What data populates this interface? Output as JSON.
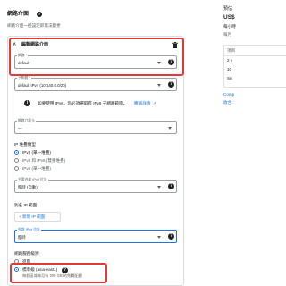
{
  "header": {
    "title": "網路介面",
    "subtitle": "網路介面一經設定即無法變更"
  },
  "nic_card": {
    "title": "編輯網路介面",
    "network": {
      "label": "網路 *",
      "value": "default"
    },
    "subnetwork": {
      "label": "子網路 *",
      "value": "default IPv4 (10.140.0.0/20)"
    },
    "ipv6_notice": {
      "text": "如要使用 IPv6，您必須選取有 IPv6 子網路範圍。",
      "link": "瞭解詳情"
    },
    "nic_type": {
      "label": "網路介面卡",
      "value": "—"
    },
    "ip_stack": {
      "heading": "IP 堆疊類型",
      "options": [
        "IPv4 (單一堆疊)",
        "IPv4 和 IPv6 (雙重堆疊)",
        "IPv6 (單一堆疊)"
      ],
      "selected": 0
    },
    "internal_ip": {
      "label": "主要內部 IPv4 位址",
      "value": "臨時 (自動)"
    },
    "alias_ip": {
      "heading": "別名 IP 範圍",
      "button": "+ 新增 IP 範圍"
    },
    "external_ip": {
      "label": "外部 IPv4 位址",
      "value": "臨時"
    },
    "network_tier": {
      "heading": "網路服務級別",
      "options": [
        "進階",
        "標準級 (asia-east1)"
      ],
      "selected": 1,
      "standard_note": "每個區域每月有 200 GB 的免費配額"
    }
  },
  "right_panel": {
    "title": "預估",
    "price": "US$",
    "line1": "每小時",
    "line2": "每月",
    "rows": [
      "項目",
      "2 v",
      "10",
      "Su"
    ],
    "link": "Comp",
    "more": "收合"
  },
  "colors": {
    "accent": "#1a73e8",
    "highlight": "#e53935"
  }
}
